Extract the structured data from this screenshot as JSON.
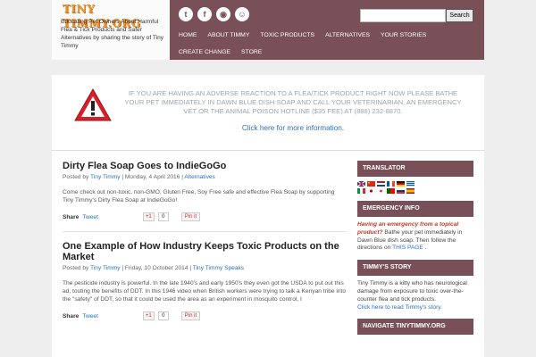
{
  "site": {
    "logo_text": "Tiny Timmy.org",
    "tagline": "Educating Pet Owners About Harmful Flea & Tick Products and Safer Alternatives by sharing the story of Tiny Timmy"
  },
  "social": [
    "twitter-icon",
    "facebook-icon",
    "rss-icon",
    "reddit-icon"
  ],
  "search": {
    "placeholder": "",
    "button": "Search"
  },
  "nav": {
    "row1": [
      "HOME",
      "ABOUT TIMMY",
      "TOXIC PRODUCTS",
      "ALTERNATIVES",
      "YOUR STORIES"
    ],
    "row2": [
      "CREATE CHANGE",
      "STORE"
    ]
  },
  "alert": {
    "text": "IF YOU ARE HAVING AN ADVERSE REACTION TO A FLEA/TICK PRODUCT RIGHT NOW PLEASE BATHE YOUR PET IMMEDIATELY IN DAWN BLUE DISH SOAP AND CALL YOUR VETERINARIAN, AN EMERGENCY VET OR THE ANIMAL POISON HOTLINE ($35 FEE) at (888) 232-8870.",
    "link": "Click here for more information."
  },
  "posts": [
    {
      "title": "Dirty Flea Soap Goes to IndieGoGo",
      "posted_by": "Posted by",
      "author": "Tiny Timmy",
      "date": "| Monday, 4 April 2016 |",
      "category": "Alternatives",
      "body": "Come check out non-toxic, non-GMO, Gluten Free, Soy Free safe and effective Flea Soap by supporting Tiny Timmy's Dirty Flea Soap at IndieGoGo!",
      "share": "Share",
      "tweet": "Tweet",
      "gplus": "+1",
      "gcount": "0",
      "pin": "Pin it"
    },
    {
      "title": "One Example of How Industry Keeps Toxic Products on the Market",
      "posted_by": "Posted by",
      "author": "Tiny Timmy",
      "date": "| Friday, 10 October 2014 |",
      "category": "Tiny Timmy Speaks",
      "body": "The pesticide industry is powerful. In the late 1940's and early 1950's they even got the USDA to put out this ad, touting the benefits of DDT. In this 1946 video when British workers were trying to talk a Kenyan tribe into the \"safety\" of DDT, so that it could be used the area as an experiment in mosquito control, I",
      "share": "Share",
      "tweet": "Tweet",
      "gplus": "+1",
      "gcount": "0",
      "pin": "Pin it"
    }
  ],
  "sidebar": {
    "translator": {
      "title": "TRANSLATOR"
    },
    "emergency": {
      "title": "EMERGENCY INFO",
      "lead": "Having an emergency from a topical product?",
      "text1": " Bathe your pet immediately in Dawn Blue dish soap. Then follow the directions on ",
      "link": "THIS PAGE",
      "text2": " ."
    },
    "story": {
      "title": "TIMMY'S STORY",
      "text": "Tiny Timmy is a kitty who has neurological damage from exposure to toxic over-the-counter flea and tick products.",
      "link": "Click here to read Timmy's story."
    },
    "navigate": {
      "title": "NAVIGATE TINYTIMMY.ORG"
    }
  },
  "colors": {
    "accent": "#7a5058",
    "link": "#2a6fc9",
    "logo": "#f2922a"
  }
}
